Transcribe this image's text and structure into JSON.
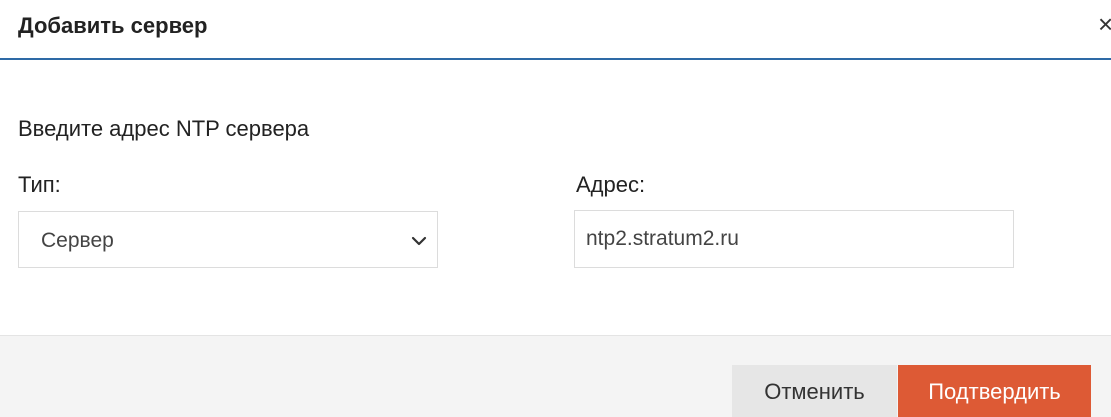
{
  "dialog": {
    "title": "Добавить сервер",
    "close_glyph": "×",
    "prompt": "Введите адрес NTP сервера"
  },
  "form": {
    "type_label": "Тип:",
    "type_value": "Сервер",
    "address_label": "Адрес:",
    "address_value": "ntp2.stratum2.ru"
  },
  "footer": {
    "cancel_label": "Отменить",
    "confirm_label": "Подтвердить"
  },
  "colors": {
    "header_border": "#2e6aa6",
    "confirm_bg": "#dd5a35",
    "cancel_bg": "#e6e6e6",
    "footer_bg": "#f4f4f4"
  },
  "icons": {
    "close": "close-icon",
    "select_arrow": "chevron-down-icon"
  }
}
